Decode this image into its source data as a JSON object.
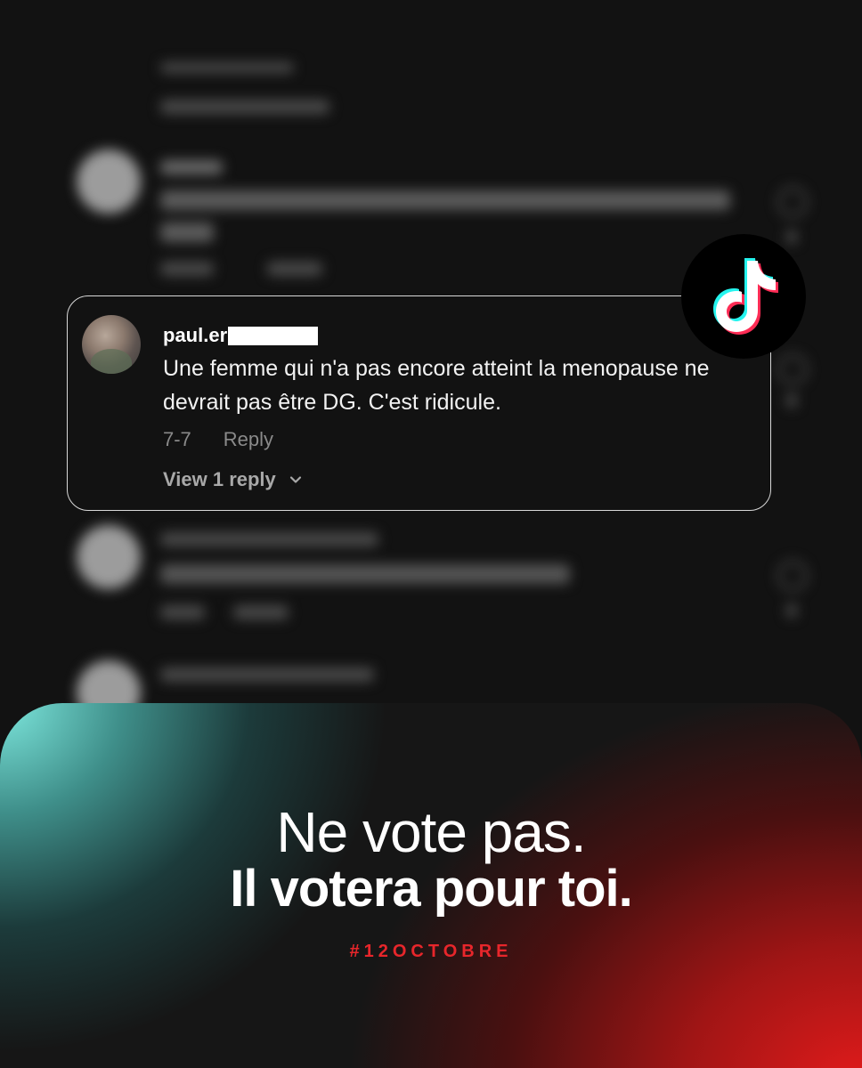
{
  "comment": {
    "username": "paul.er",
    "text": "Une femme qui n'a pas encore atteint la menopause ne devrait pas être DG. C'est ridicule.",
    "date": "7-7",
    "reply_label": "Reply",
    "view_replies_label": "View 1 reply"
  },
  "icons": {
    "logo": "tiktok-logo-icon",
    "chevron": "chevron-down-icon"
  },
  "banner": {
    "line1": "Ne vote pas.",
    "line2": "Il votera pour toi.",
    "hashtag": "#12OCTOBRE"
  },
  "colors": {
    "background": "#121212",
    "card_border": "#d8d8d8",
    "hashtag": "#e8262b",
    "teal_glow": "#7ee8de",
    "red_glow": "#e21b1b",
    "tiktok_cyan": "#25f4ee",
    "tiktok_pink": "#fe2c55"
  }
}
